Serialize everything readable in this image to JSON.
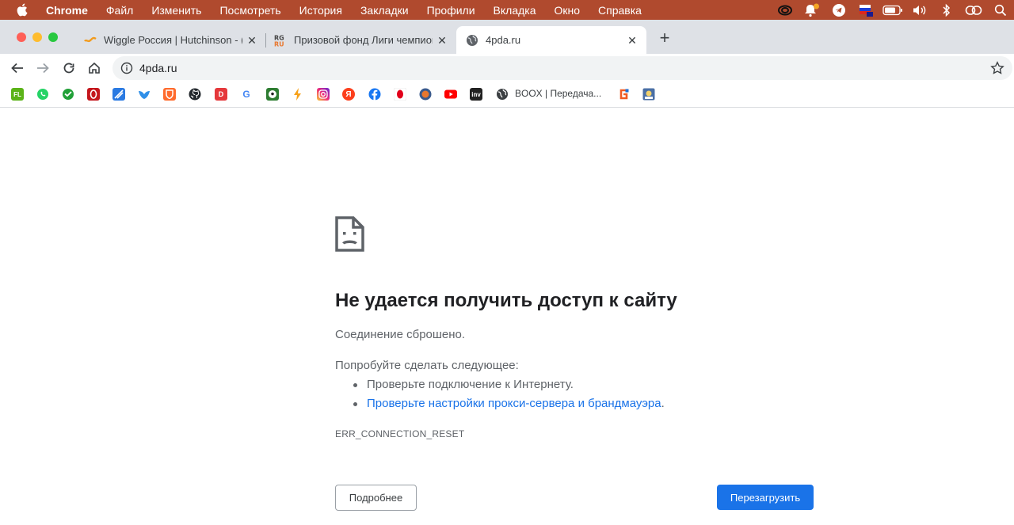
{
  "menubar": {
    "app_name": "Chrome",
    "items": [
      "Файл",
      "Изменить",
      "Посмотреть",
      "История",
      "Закладки",
      "Профили",
      "Вкладка",
      "Окно",
      "Справка"
    ],
    "status_icons": [
      "creative-cloud-icon",
      "notification-icon",
      "telegram-icon",
      "russian-flag-icon",
      "battery-icon",
      "volume-icon",
      "bluetooth-icon",
      "link-icon",
      "search-icon"
    ]
  },
  "tabs": [
    {
      "title": "Wiggle Россия | Hutchinson - (",
      "favicon": "wiggle-icon",
      "active": false
    },
    {
      "title": "Призовой фонд Лиги чемпион",
      "favicon": "rg-icon",
      "active": false
    },
    {
      "title": "4pda.ru",
      "favicon": "globe-icon",
      "active": true
    }
  ],
  "toolbar": {
    "url": "4pda.ru"
  },
  "bookmarks": {
    "fl_label": "FL",
    "d_label": "D",
    "g_label": "G",
    "ya_label": "Я",
    "inv_label": "inv",
    "boox_label": "BOOX | Передача...",
    "icons": [
      "fl-icon",
      "whatsapp-icon",
      "sber-icon",
      "red-icon",
      "blue-icon",
      "bird-icon",
      "shield-icon",
      "github-icon",
      "d-icon",
      "google-icon",
      "football-icon",
      "bolt-icon",
      "instagram-icon",
      "yandex-icon",
      "facebook-icon",
      "opera-icon",
      "circle-icon",
      "youtube-icon",
      "inv-icon",
      "globe-icon",
      "g-icon",
      "game-icon"
    ]
  },
  "error": {
    "heading": "Не удается получить доступ к сайту",
    "subtitle": "Соединение сброшено.",
    "try_label": "Попробуйте сделать следующее:",
    "suggestion_1": "Проверьте подключение к Интернету.",
    "suggestion_2_link": "Проверьте настройки прокси-сервера и брандмауэра",
    "suggestion_2_end": ".",
    "code": "ERR_CONNECTION_RESET",
    "details_button": "Подробнее",
    "reload_button": "Перезагрузить"
  },
  "colors": {
    "menubar": "#b04a2e",
    "accent": "#1a73e8",
    "tabstrip": "#dee1e6"
  }
}
